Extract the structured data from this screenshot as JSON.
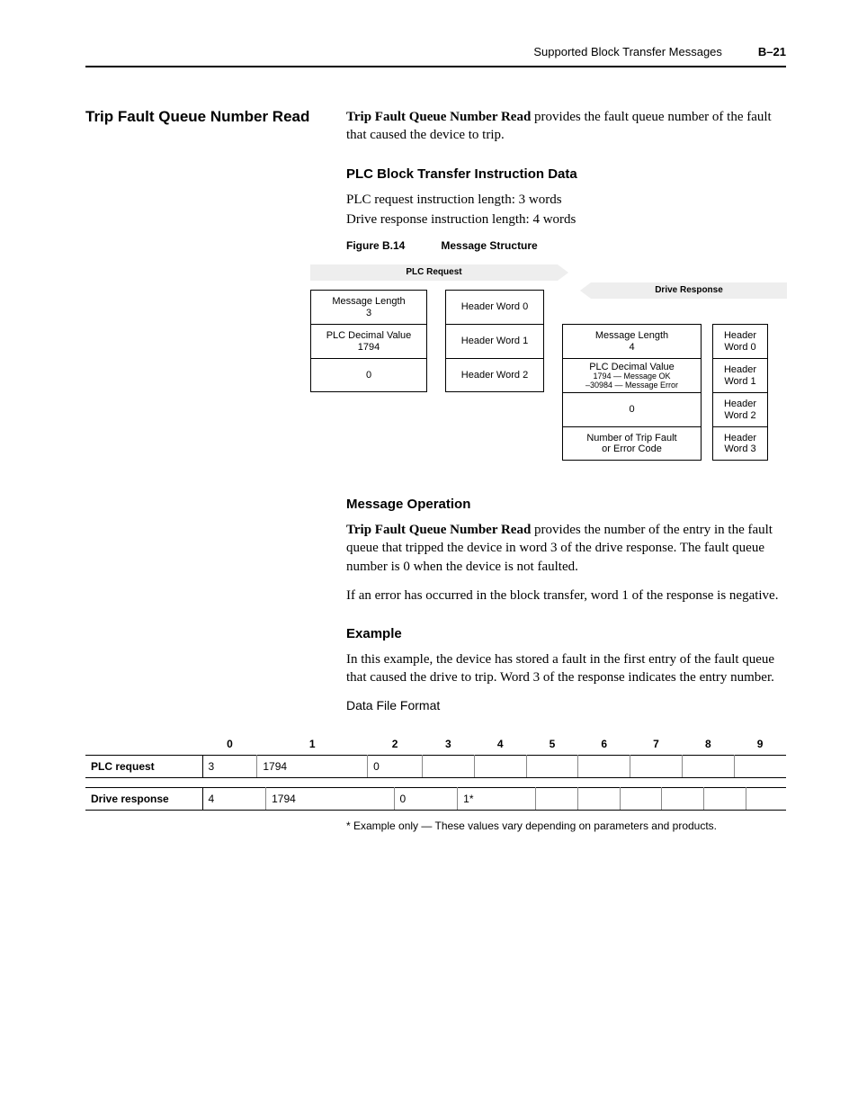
{
  "header": {
    "running": "Supported Block Transfer Messages",
    "pagenum": "B–21"
  },
  "section_title": "Trip Fault Queue Number Read",
  "intro_strong": "Trip Fault Queue Number Read",
  "intro_rest": " provides the fault queue number of the fault that caused the device to trip.",
  "plc_head": "PLC Block Transfer Instruction Data",
  "plc_line1": "PLC request instruction length: 3 words",
  "plc_line2": "Drive response instruction length: 4 words",
  "fig": {
    "num": "Figure B.14",
    "title": "Message Structure"
  },
  "diagram": {
    "plc_label": "PLC Request",
    "drive_label": "Drive Response",
    "plc_main": [
      {
        "l1": "Message Length",
        "l2": "3"
      },
      {
        "l1": "PLC Decimal Value",
        "l2": "1794"
      },
      {
        "l1": "0",
        "l2": ""
      }
    ],
    "plc_hdr": [
      "Header Word 0",
      "Header Word 1",
      "Header Word 2"
    ],
    "resp_main": [
      {
        "l1": "Message Length",
        "l2": "4"
      },
      {
        "l1": "PLC Decimal Value",
        "s1": "1794 — Message OK",
        "s2": "–30984 — Message Error"
      },
      {
        "l1": "0"
      },
      {
        "l1": "Number of Trip Fault",
        "l2": "or Error Code"
      }
    ],
    "resp_hdr": [
      "Header Word 0",
      "Header Word 1",
      "Header Word 2",
      "Header Word 3"
    ]
  },
  "msgop_head": "Message Operation",
  "msgop_strong": "Trip Fault Queue Number Read",
  "msgop_rest": " provides the number of the entry in the fault queue that tripped the device in word 3 of the drive response. The fault queue number is 0 when the device is not faulted.",
  "msgop_p2": "If an error has occurred in the block transfer, word 1 of the response is negative.",
  "example_head": "Example",
  "example_p": "In this example, the device has stored a fault in the first entry of the fault queue that caused the drive to trip. Word 3 of the response indicates the entry number.",
  "data_heading": "Data File Format",
  "cols": [
    "",
    "0",
    "1",
    "2",
    "3",
    "4",
    "5",
    "6",
    "7",
    "8",
    "9"
  ],
  "row1": {
    "label": "PLC request",
    "cells": [
      "3",
      "1794",
      "0",
      "",
      "",
      "",
      "",
      "",
      "",
      ""
    ]
  },
  "row2": {
    "label": "Drive response",
    "cells": [
      "4",
      "1794",
      "0",
      "1*",
      "",
      "",
      "",
      "",
      "",
      ""
    ]
  },
  "footnote": "* Example only — These values vary depending on parameters and products.",
  "chart_data": [
    {
      "type": "table",
      "title": "PLC request",
      "categories": [
        "0",
        "1",
        "2",
        "3",
        "4",
        "5",
        "6",
        "7",
        "8",
        "9"
      ],
      "values": [
        3,
        1794,
        0,
        null,
        null,
        null,
        null,
        null,
        null,
        null
      ]
    },
    {
      "type": "table",
      "title": "Drive response",
      "categories": [
        "0",
        "1",
        "2",
        "3",
        "4",
        "5",
        "6",
        "7",
        "8",
        "9"
      ],
      "values": [
        4,
        1794,
        0,
        "1*",
        null,
        null,
        null,
        null,
        null,
        null
      ]
    }
  ]
}
